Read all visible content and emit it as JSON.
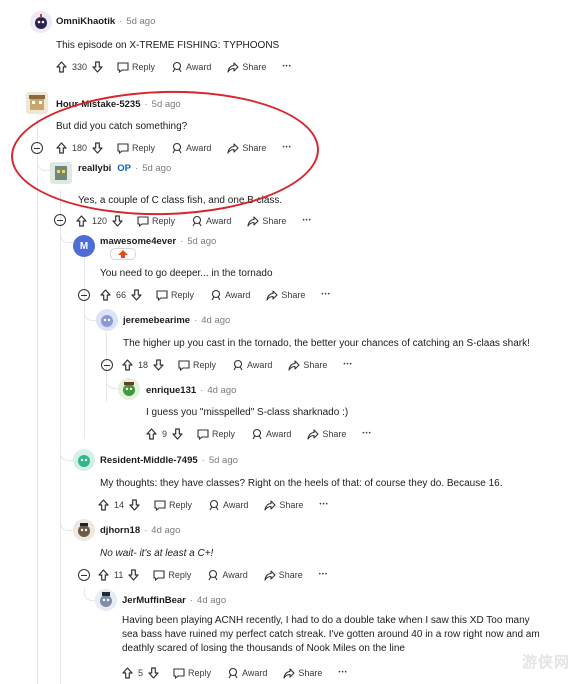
{
  "colors": {
    "highlight": "#d8262e",
    "op": "#0a65c2",
    "text": "#1c1c1c",
    "meta": "#7c7c7c"
  },
  "action_labels": {
    "reply": "Reply",
    "award": "Award",
    "share": "Share",
    "more": "•••"
  },
  "comments": [
    {
      "author": "OmniKhaotik",
      "age": "5d ago",
      "body": "This episode on X-TREME FISHING: TYPHOONS",
      "votes": "330"
    },
    {
      "author": "Hour-Mistake-5235",
      "age": "5d ago",
      "body": "But did you catch something?",
      "votes": "180"
    },
    {
      "author": "reallybi",
      "op_label": "OP",
      "age": "5d ago",
      "body": "Yes, a couple of C class fish, and one B class.",
      "votes": "120"
    },
    {
      "author": "mawesome4ever",
      "age": "5d ago",
      "body": "You need to go deeper... in the tornado",
      "votes": "66"
    },
    {
      "author": "jeremebearime",
      "age": "4d ago",
      "body": "The higher up you cast in the tornado, the better your chances of catching an S-claas shark!",
      "votes": "18"
    },
    {
      "author": "enrique131",
      "age": "4d ago",
      "body": "I guess you \"misspelled\" S-class sharknado :)",
      "votes": "9"
    },
    {
      "author": "Resident-Middle-7495",
      "age": "5d ago",
      "body": "My thoughts: they have classes? Right on the heels of that: of course they do.  Because 16.",
      "votes": "14"
    },
    {
      "author": "djhorn18",
      "age": "4d ago",
      "body": "No wait- it's at least a C+!",
      "votes": "11"
    },
    {
      "author": "JerMuffinBear",
      "age": "4d ago",
      "body": "Having been playing ACNH recently, I had to do a double take when I saw this XD Too many sea bass have ruined my perfect catch streak. I've gotten around 40 in a row right now and am deathly scared of losing the thousands of Nook Miles on the line",
      "votes": "5"
    }
  ],
  "watermark": "游侠网"
}
